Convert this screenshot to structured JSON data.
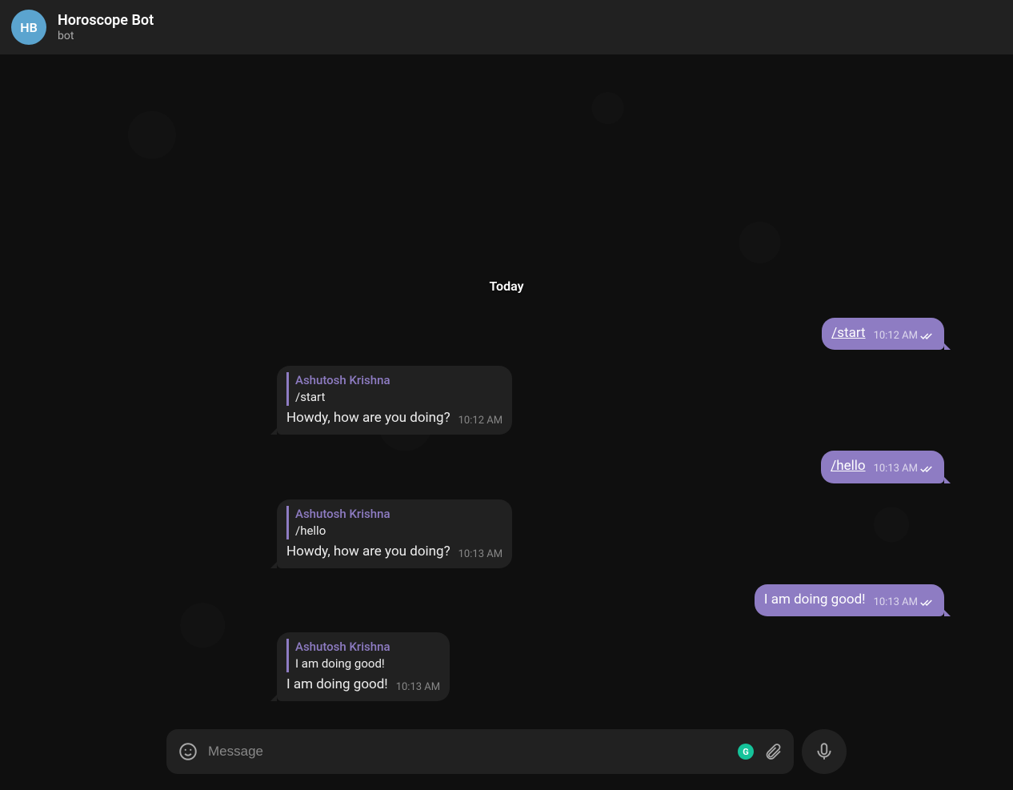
{
  "header": {
    "avatar_initials": "HB",
    "title": "Horoscope Bot",
    "subtitle": "bot"
  },
  "chat": {
    "date_label": "Today",
    "messages": [
      {
        "direction": "out",
        "text": "/start",
        "is_link": true,
        "time": "10:12 AM",
        "read": true
      },
      {
        "direction": "in",
        "reply_name": "Ashutosh Krishna",
        "reply_text": "/start",
        "text": "Howdy, how are you doing?",
        "time": "10:12 AM"
      },
      {
        "direction": "out",
        "text": "/hello",
        "is_link": true,
        "time": "10:13 AM",
        "read": true
      },
      {
        "direction": "in",
        "reply_name": "Ashutosh Krishna",
        "reply_text": "/hello",
        "text": "Howdy, how are you doing?",
        "time": "10:13 AM"
      },
      {
        "direction": "out",
        "text": "I am doing good!",
        "is_link": false,
        "time": "10:13 AM",
        "read": true
      },
      {
        "direction": "in",
        "reply_name": "Ashutosh Krishna",
        "reply_text": "I am doing good!",
        "text": "I am doing good!",
        "time": "10:13 AM"
      }
    ]
  },
  "composer": {
    "placeholder": "Message",
    "value": "",
    "grammarly_badge_letter": "G"
  },
  "icons": {
    "emoji": "emoji-icon",
    "attach": "attach-icon",
    "mic": "mic-icon",
    "read_checks": "double-check-icon"
  }
}
